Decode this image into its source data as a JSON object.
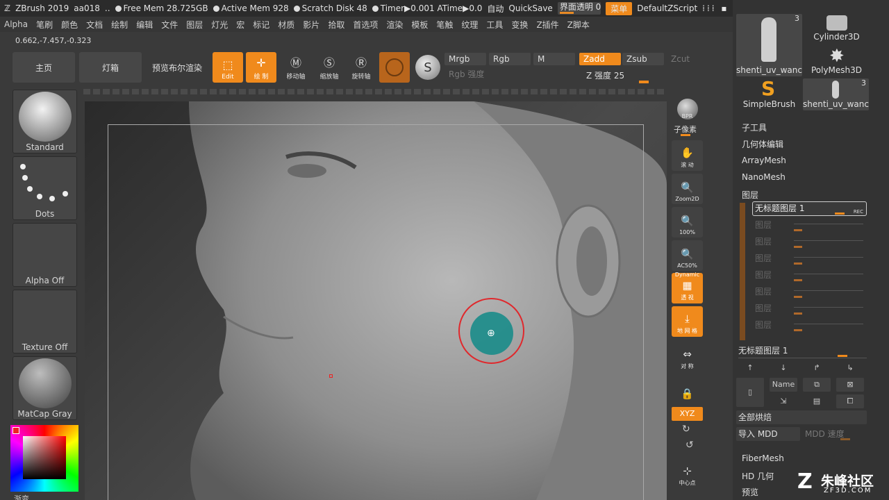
{
  "titlebar": {
    "app": "ZBrush 2019",
    "doc": "aa018",
    "dots": "..",
    "free_mem": "Free Mem 28.725GB",
    "active_mem": "Active Mem 928",
    "scratch_disk": "Scratch Disk 48",
    "timer": "Timer▶0.001 ATime▶0.0",
    "auto": "自动",
    "quicksave": "QuickSave",
    "ui_transparency": "界面透明 0",
    "menu_btn": "菜单",
    "script": "DefaultZScript"
  },
  "menubar": [
    "Alpha",
    "笔刷",
    "颜色",
    "文档",
    "绘制",
    "编辑",
    "文件",
    "图层",
    "灯光",
    "宏",
    "标记",
    "材质",
    "影片",
    "拾取",
    "首选项",
    "渲染",
    "模板",
    "笔触",
    "纹理",
    "工具",
    "变换",
    "Z插件",
    "Z脚本"
  ],
  "coords": "0.662,-7.457,-0.323",
  "shelf": {
    "home": "主页",
    "lightbox": "灯箱",
    "preview_render": "预览布尔渲染",
    "edit": "Edit",
    "draw": "绘 制",
    "move": "移动轴",
    "scale": "缩放轴",
    "rotate": "旋转轴"
  },
  "channels": {
    "mrgb": "Mrgb",
    "rgb": "Rgb",
    "m": "M",
    "zadd": "Zadd",
    "zsub": "Zsub",
    "zcut": "Zcut",
    "rgb_intensity": "Rgb 强度",
    "z_intensity": "Z 强度 25"
  },
  "left_panel": {
    "brush": "Standard",
    "stroke": "Dots",
    "alpha": "Alpha Off",
    "texture": "Texture Off",
    "material": "MatCap Gray",
    "gradient": "渐变"
  },
  "right_tools": {
    "bpr": "BPR",
    "subpixel": "子像素",
    "scroll": "滚 动",
    "zoom2d": "Zoom2D",
    "hundred": "100%",
    "ac50": "AC50%",
    "dynamic": "Dynamic",
    "persp": "透 视",
    "floor": "地 网 格",
    "sym": "对 称",
    "xyz": "XYZ",
    "center": "中心点"
  },
  "right_panel": {
    "thumbs": [
      {
        "label": "shenti_uv_wanc",
        "count": "3"
      },
      {
        "label": "Cylinder3D",
        "count": ""
      },
      {
        "label": "PolyMesh3D",
        "count": ""
      },
      {
        "label": "SimpleBrush",
        "count": ""
      },
      {
        "label": "shenti_uv_wanc",
        "count": "3"
      }
    ],
    "subtool": "子工具",
    "geometry": "几何体编辑",
    "arraymesh": "ArrayMesh",
    "nanomesh": "NanoMesh",
    "layers": "图层",
    "layer_active": "无标题图层 1",
    "rec": "REC",
    "layer_slot": "图层",
    "layer_footer": "无标题图层 1",
    "name_btn": "Name",
    "bake_all": "全部烘焙",
    "import_mdd": "导入 MDD",
    "mdd_speed": "MDD 速度",
    "fibermesh": "FiberMesh",
    "hd_geom": "HD 几何",
    "preview": "预览"
  },
  "watermark": {
    "brand": "朱峰社区",
    "url": "ZF3D.COM"
  }
}
